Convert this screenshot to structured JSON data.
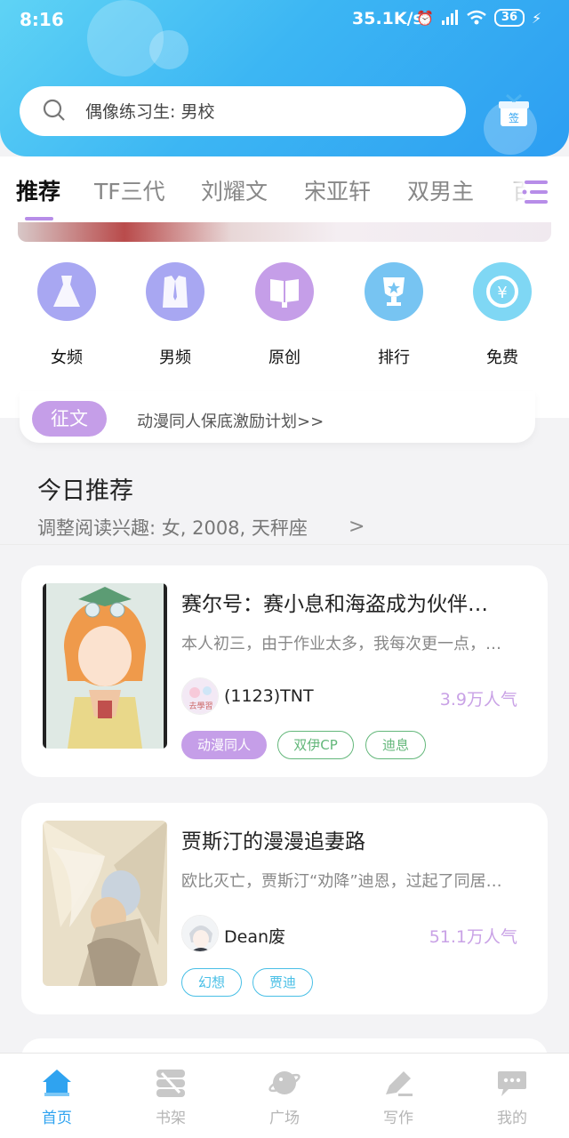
{
  "status": {
    "time": "8:16",
    "net_speed": "35.1K/s",
    "battery": "36"
  },
  "search": {
    "placeholder": "偶像练习生: 男校"
  },
  "gift": {
    "label": "签"
  },
  "tabs": [
    {
      "label": "推荐"
    },
    {
      "label": "TF三代"
    },
    {
      "label": "刘耀文"
    },
    {
      "label": "宋亚轩"
    },
    {
      "label": "双男主"
    },
    {
      "label": "百"
    }
  ],
  "categories": [
    {
      "label": "女频",
      "icon": "dress-icon"
    },
    {
      "label": "男频",
      "icon": "shirt-icon"
    },
    {
      "label": "原创",
      "icon": "book-icon"
    },
    {
      "label": "排行",
      "icon": "trophy-icon"
    },
    {
      "label": "免费",
      "icon": "yen-icon"
    }
  ],
  "essay": {
    "badge": "征文",
    "text": "动漫同人保底激励计划>>"
  },
  "today": {
    "title": "今日推荐",
    "subtitle": "调整阅读兴趣: 女, 2008, 天秤座"
  },
  "books": [
    {
      "title": "赛尔号：赛小息和海盗成为伙伴…",
      "desc": "本人初三，由于作业太多，我每次更一点，…",
      "author": "(1123)TNT",
      "popularity": "3.9万人气",
      "avatar_text": "去學習",
      "tags": [
        "动漫同人",
        "双伊CP",
        "迪息"
      ]
    },
    {
      "title": "贾斯汀的漫漫追妻路",
      "desc": "欧比灭亡，贾斯汀“劝降”迪恩，过起了同居…",
      "author": "Dean废",
      "popularity": "51.1万人气",
      "tags": [
        "幻想",
        "贾迪"
      ]
    }
  ],
  "nav": [
    {
      "label": "首页",
      "icon": "home-icon",
      "active": true
    },
    {
      "label": "书架",
      "icon": "bookshelf-icon"
    },
    {
      "label": "广场",
      "icon": "planet-icon"
    },
    {
      "label": "写作",
      "icon": "pen-icon"
    },
    {
      "label": "我的",
      "icon": "chat-icon"
    }
  ],
  "colors": {
    "accent": "#2fa3f0",
    "purple": "#c59ee8",
    "green": "#63b77a",
    "cyan": "#48bfe6"
  }
}
